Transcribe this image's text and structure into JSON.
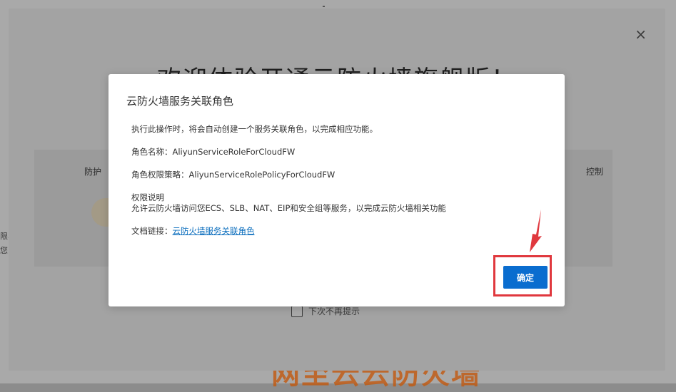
{
  "background": {
    "welcome_title": "欢迎体验开通云防火墙旗舰版！",
    "feature_left_label": "防护",
    "feature_right_label": "控制",
    "checkbox_label": "下次不再提示",
    "left_edge_text": [
      "限、",
      "您"
    ],
    "bottom_heading": "网至云云防火墙",
    "close_glyph": "×"
  },
  "dialog": {
    "title": "云防火墙服务关联角色",
    "intro": "执行此操作时，将会自动创建一个服务关联角色，以完成相应功能。",
    "role_name": "角色名称：AliyunServiceRoleForCloudFW",
    "role_policy": "角色权限策略：AliyunServiceRolePolicyForCloudFW",
    "permission_title": "权限说明",
    "permission_desc": "允许云防火墙访问您ECS、SLB、NAT、EIP和安全组等服务，以完成云防火墙相关功能",
    "doc_label": "文档链接：",
    "doc_link": "云防火墙服务关联角色",
    "confirm_label": "确定"
  },
  "colors": {
    "primary": "#0a6dcf",
    "link": "#0a6dbd",
    "annotation": "#e0383e"
  }
}
